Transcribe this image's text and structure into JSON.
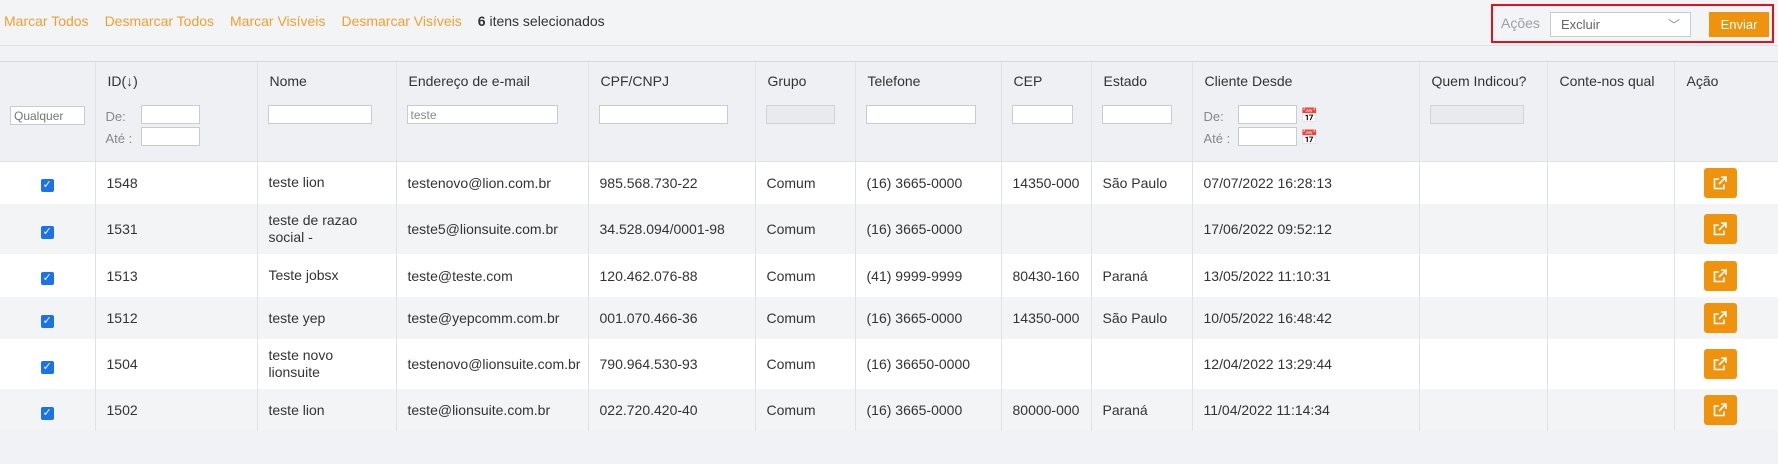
{
  "toolbar": {
    "mark_all": "Marcar Todos",
    "unmark_all": "Desmarcar Todos",
    "mark_visible": "Marcar Visíveis",
    "unmark_visible": "Desmarcar Visíveis",
    "selected_count": "6",
    "selected_suffix": " itens selecionados",
    "actions_label": "Ações",
    "action_value": "Excluir",
    "send_label": "Enviar"
  },
  "columns": {
    "id": "ID",
    "id_sort": "(↓)",
    "name": "Nome",
    "email": "Endereço de e-mail",
    "doc": "CPF/CNPJ",
    "group": "Grupo",
    "phone": "Telefone",
    "cep": "CEP",
    "state": "Estado",
    "since": "Cliente Desde",
    "referrer": "Quem Indicou?",
    "source": "Conte-nos qual",
    "action": "Ação"
  },
  "filters": {
    "checkbox_placeholder": "Qualquer",
    "from_label": "De:",
    "to_label": "Até :",
    "email_value": "teste"
  },
  "rows": [
    {
      "id": "1548",
      "name": "teste lion",
      "email": "testenovo@lion.com.br",
      "doc": "985.568.730-22",
      "group": "Comum",
      "phone": "(16) 3665-0000",
      "cep": "14350-000",
      "state": "São Paulo",
      "since": "07/07/2022 16:28:13"
    },
    {
      "id": "1531",
      "name": "teste de razao social -",
      "email": "teste5@lionsuite.com.br",
      "doc": "34.528.094/0001-98",
      "group": "Comum",
      "phone": "(16) 3665-0000",
      "cep": "",
      "state": "",
      "since": "17/06/2022 09:52:12"
    },
    {
      "id": "1513",
      "name": "Teste jobsx",
      "email": "teste@teste.com",
      "doc": "120.462.076-88",
      "group": "Comum",
      "phone": "(41) 9999-9999",
      "cep": "80430-160",
      "state": "Paraná",
      "since": "13/05/2022 11:10:31"
    },
    {
      "id": "1512",
      "name": "teste yep",
      "email": "teste@yepcomm.com.br",
      "doc": "001.070.466-36",
      "group": "Comum",
      "phone": "(16) 3665-0000",
      "cep": "14350-000",
      "state": "São Paulo",
      "since": "10/05/2022 16:48:42"
    },
    {
      "id": "1504",
      "name": "teste novo lionsuite",
      "email": "testenovo@lionsuite.com.br",
      "doc": "790.964.530-93",
      "group": "Comum",
      "phone": "(16) 36650-0000",
      "cep": "",
      "state": "",
      "since": "12/04/2022 13:29:44"
    },
    {
      "id": "1502",
      "name": "teste lion",
      "email": "teste@lionsuite.com.br",
      "doc": "022.720.420-40",
      "group": "Comum",
      "phone": "(16) 3665-0000",
      "cep": "80000-000",
      "state": "Paraná",
      "since": "11/04/2022 11:14:34"
    }
  ],
  "icons": {
    "checkbox": "checkmark-icon",
    "calendar": "calendar-icon",
    "open": "external-link-icon",
    "dropdown": "chevron-down-icon"
  },
  "colors": {
    "accent": "#f0930c",
    "link": "#f0a030",
    "highlight_border": "#e3101e",
    "checkbox": "#1a73e8"
  }
}
